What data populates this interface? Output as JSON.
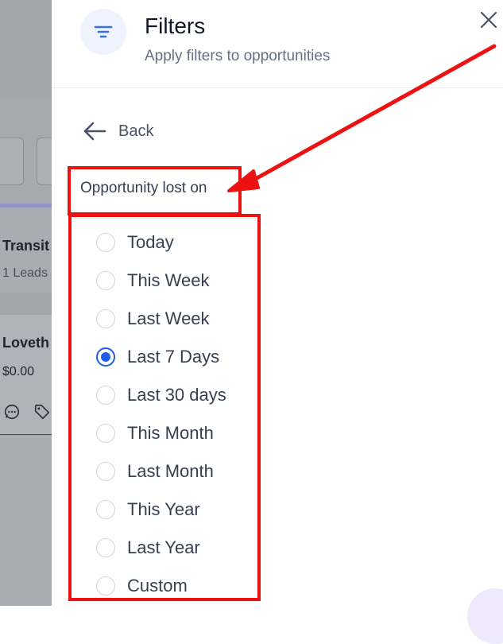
{
  "background": {
    "stage_title": "Transit",
    "stage_sub": "1 Leads",
    "card_name": "Loveth",
    "card_value": "$0.00"
  },
  "panel": {
    "title": "Filters",
    "subtitle": "Apply filters to opportunities",
    "back_label": "Back",
    "section_label": "Opportunity lost on",
    "options": [
      {
        "label": "Today",
        "checked": false
      },
      {
        "label": "This Week",
        "checked": false
      },
      {
        "label": "Last Week",
        "checked": false
      },
      {
        "label": "Last 7 Days",
        "checked": true
      },
      {
        "label": "Last 30 days",
        "checked": false
      },
      {
        "label": "This Month",
        "checked": false
      },
      {
        "label": "Last Month",
        "checked": false
      },
      {
        "label": "This Year",
        "checked": false
      },
      {
        "label": "Last Year",
        "checked": false
      },
      {
        "label": "Custom",
        "checked": false
      }
    ]
  },
  "icons": {
    "header": "filter-icon",
    "close": "close-icon",
    "back": "arrow-left-icon"
  },
  "colors": {
    "accent": "#1f5fe8",
    "annotation": "#ee1111"
  }
}
